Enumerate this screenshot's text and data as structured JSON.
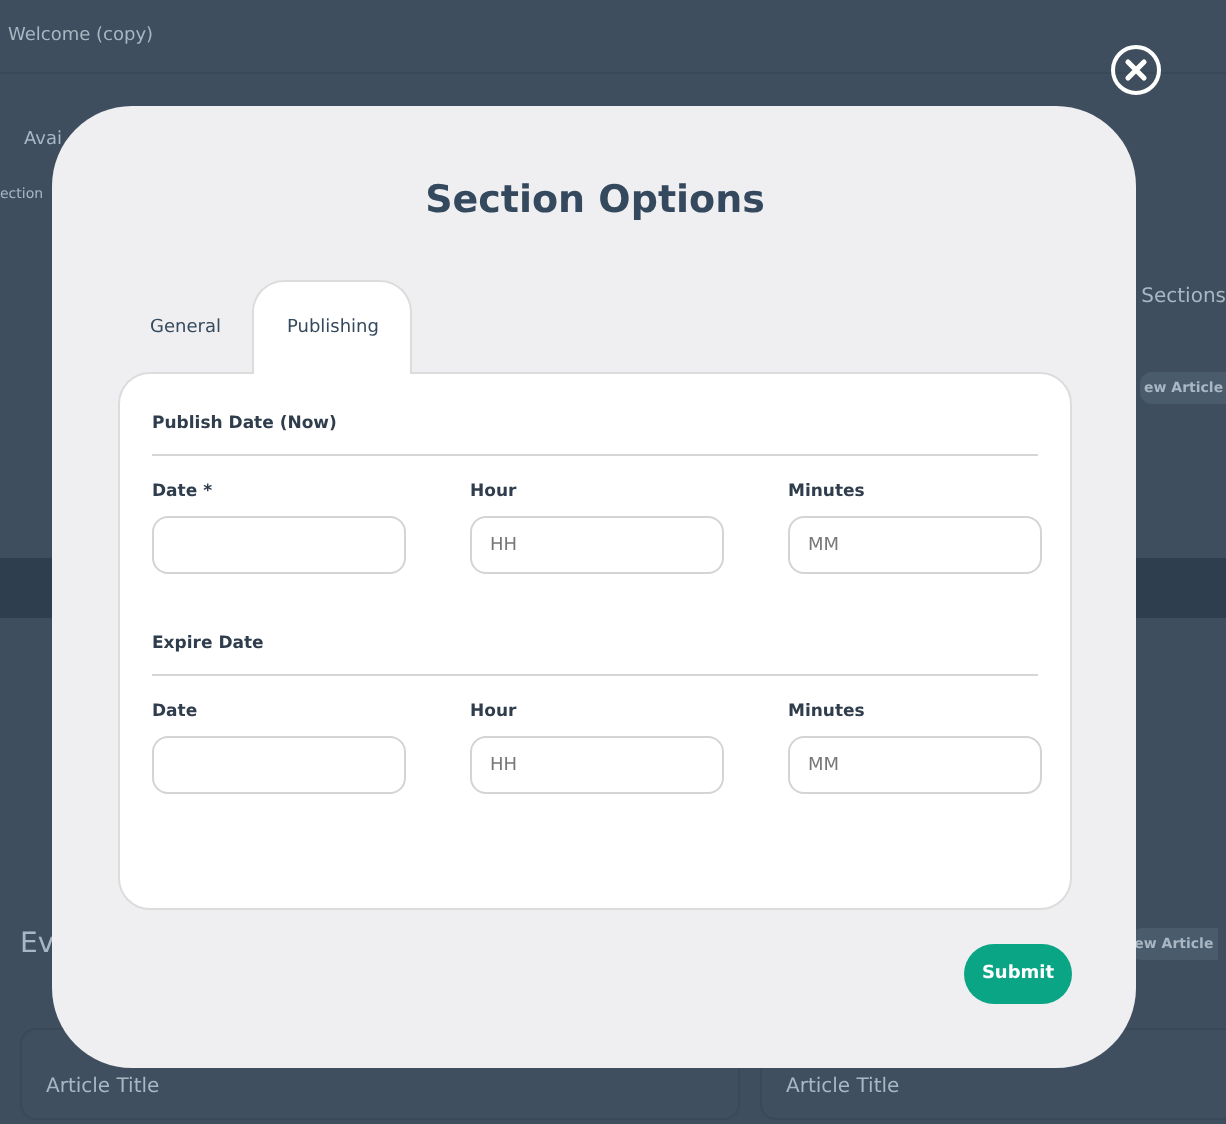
{
  "background": {
    "page_title": "Welcome (copy)",
    "label_1": "Avai",
    "label_2": "ection",
    "sections_heading": "Sections",
    "new_article_buttons": [
      "ew Article",
      "ew Article"
    ],
    "group_heading": "Ev",
    "article_titles": [
      "Article Title",
      "Article Title"
    ]
  },
  "modal": {
    "title": "Section Options",
    "tabs": [
      {
        "label": "General",
        "selected": false
      },
      {
        "label": "Publishing",
        "selected": true
      }
    ],
    "groups": [
      {
        "heading": "Publish Date (Now)",
        "fields": [
          {
            "label": "Date *"
          },
          {
            "label": "Hour",
            "placeholder": "HH"
          },
          {
            "label": "Minutes",
            "placeholder": "MM"
          }
        ]
      },
      {
        "heading": "Expire Date",
        "fields": [
          {
            "label": "Date"
          },
          {
            "label": "Hour",
            "placeholder": "HH"
          },
          {
            "label": "Minutes",
            "placeholder": "MM"
          }
        ]
      }
    ],
    "submit": "Submit"
  }
}
